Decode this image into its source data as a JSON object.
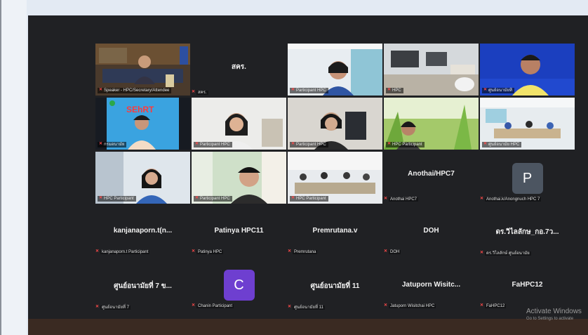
{
  "meeting": {
    "tiles": [
      {
        "id": "t1",
        "kind": "video",
        "name": "Speaker - HPC/Secretary/Attendee",
        "speaking": true
      },
      {
        "id": "t2",
        "kind": "text",
        "title": "สคร.",
        "label": "สคร."
      },
      {
        "id": "t3",
        "kind": "video",
        "name": "Participant HPC"
      },
      {
        "id": "t4",
        "kind": "video",
        "name": "HPC"
      },
      {
        "id": "t5",
        "kind": "video",
        "name": "ศูนย์อนามัยที่"
      },
      {
        "id": "t6",
        "kind": "video",
        "name": "กรมอนามัย",
        "slide_text": "SEhRT"
      },
      {
        "id": "t7",
        "kind": "video",
        "name": "Participant HPC"
      },
      {
        "id": "t8",
        "kind": "video",
        "name": "Participant HPC"
      },
      {
        "id": "t9",
        "kind": "video",
        "name": "HPC Participant"
      },
      {
        "id": "t10",
        "kind": "video",
        "name": "ศูนย์อนามัย HPC"
      },
      {
        "id": "t11",
        "kind": "video",
        "name": "HPC Participant"
      },
      {
        "id": "t12",
        "kind": "video",
        "name": "Participant HPC"
      },
      {
        "id": "t13",
        "kind": "video",
        "name": "HPC Participant"
      },
      {
        "id": "t14",
        "kind": "text",
        "title": "Anothai/HPC7",
        "label": "Anothai HPC7"
      },
      {
        "id": "t15",
        "kind": "avatar",
        "letter": "P",
        "label": "Anothai.k/Anongnuch HPC 7"
      },
      {
        "id": "t16",
        "kind": "text",
        "title": "kanjanaporn.t(n...",
        "label": "kanjanaporn.t Participant"
      },
      {
        "id": "t17",
        "kind": "text",
        "title": "Patinya HPC11",
        "label": "Patinya HPC"
      },
      {
        "id": "t18",
        "kind": "text",
        "title": "Premrutana.v",
        "label": "Premrutana"
      },
      {
        "id": "t19",
        "kind": "text",
        "title": "DOH",
        "label": "DOH"
      },
      {
        "id": "t20",
        "kind": "text",
        "title": "ดร.วิไลลักษ_กอ.7ว...",
        "label": "ดร.วิไลลักษ์ ศูนย์อนามัย"
      },
      {
        "id": "t21",
        "kind": "text",
        "title": "ศูนย์อนามัยที่ 7 ข...",
        "label": "ศูนย์อนามัยที่ 7"
      },
      {
        "id": "t22",
        "kind": "avatar",
        "letter": "C",
        "label": "Chanin Participant"
      },
      {
        "id": "t23",
        "kind": "text",
        "title": "ศูนย์อนามัยที่ 11",
        "label": "ศูนย์อนามัยที่ 11"
      },
      {
        "id": "t24",
        "kind": "text",
        "title": "Jatuporn Wisitc...",
        "label": "Jatuporn Wisitchai HPC"
      },
      {
        "id": "t25",
        "kind": "text",
        "title": "FaHPC12",
        "label": "FaHPC12"
      }
    ]
  },
  "watermark": {
    "title": "Activate Windows",
    "subtitle": "Go to Settings to activate"
  },
  "colors": {
    "background": "#202124",
    "speaker_outline": "#3ddc5f",
    "mic_muted": "#ff4a4a"
  }
}
